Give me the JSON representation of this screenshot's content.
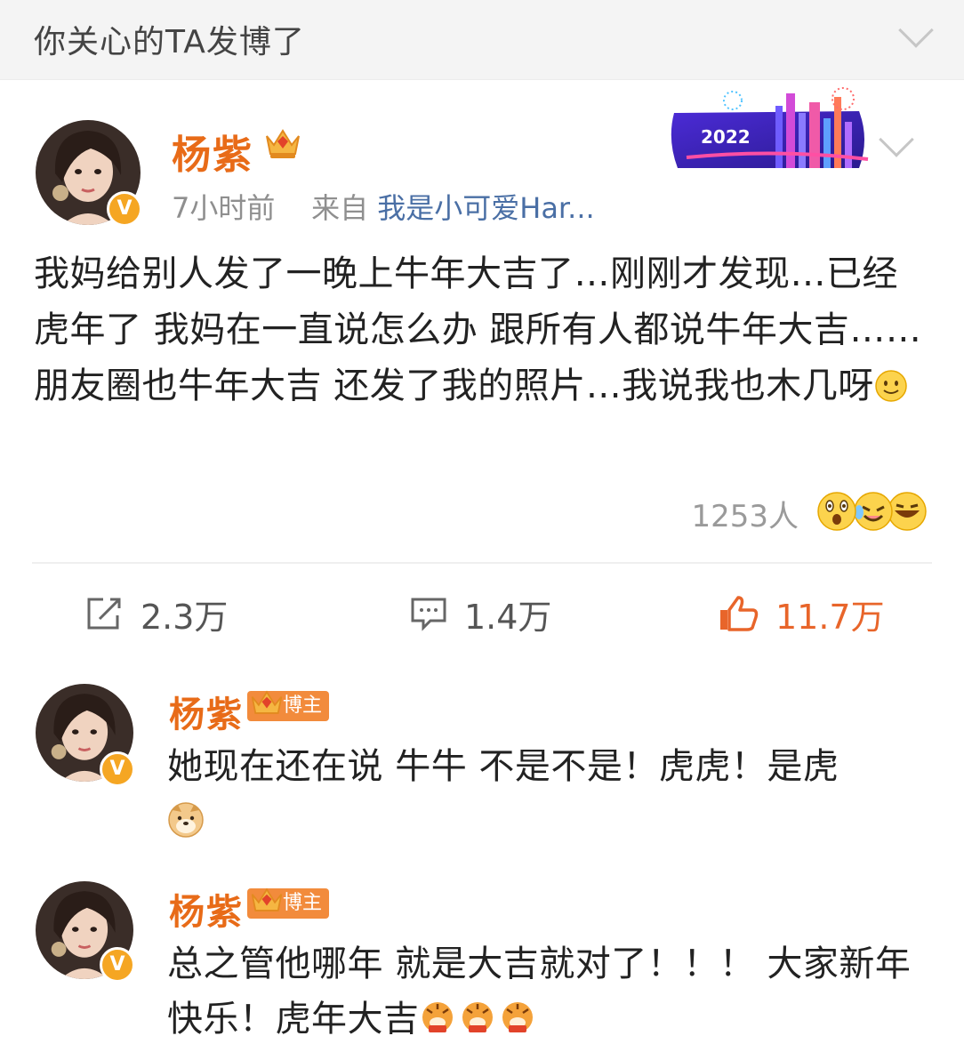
{
  "topbar": {
    "title": "你关心的TA发博了"
  },
  "post": {
    "author": "杨紫",
    "time": "7小时前",
    "source_prefix": "来自",
    "source": "我是小可爱Har...",
    "banner_text": "2022",
    "text": "我妈给别人发了一晚上牛年大吉了…刚刚才发现…已经虎年了 我妈在一直说怎么办 跟所有人都说牛年大吉……朋友圈也牛年大吉 还发了我的照片…我说我也木几呀",
    "text_emoji": "smile-emoji",
    "reactions_count": "1253人",
    "reaction_emojis": [
      "surprised-emoji",
      "tears-of-joy-emoji",
      "grinning-emoji"
    ]
  },
  "actions": {
    "repost": "2.3万",
    "comment": "1.4万",
    "like": "11.7万"
  },
  "comments": [
    {
      "author": "杨紫",
      "badge": "博主",
      "text": "她现在还在说 牛牛 不是不是！虎虎！是虎",
      "trailing_emoji": "doge-emoji"
    },
    {
      "author": "杨紫",
      "badge": "博主",
      "text": "总之管他哪年 就是大吉就对了！！！ 大家新年快乐！虎年大吉",
      "trailing_emoji": "tiger-emoji-x3"
    }
  ],
  "colors": {
    "name": "#e86b18",
    "like": "#e8652a",
    "link": "#4a6fa5",
    "badge": "#f28b3c"
  }
}
